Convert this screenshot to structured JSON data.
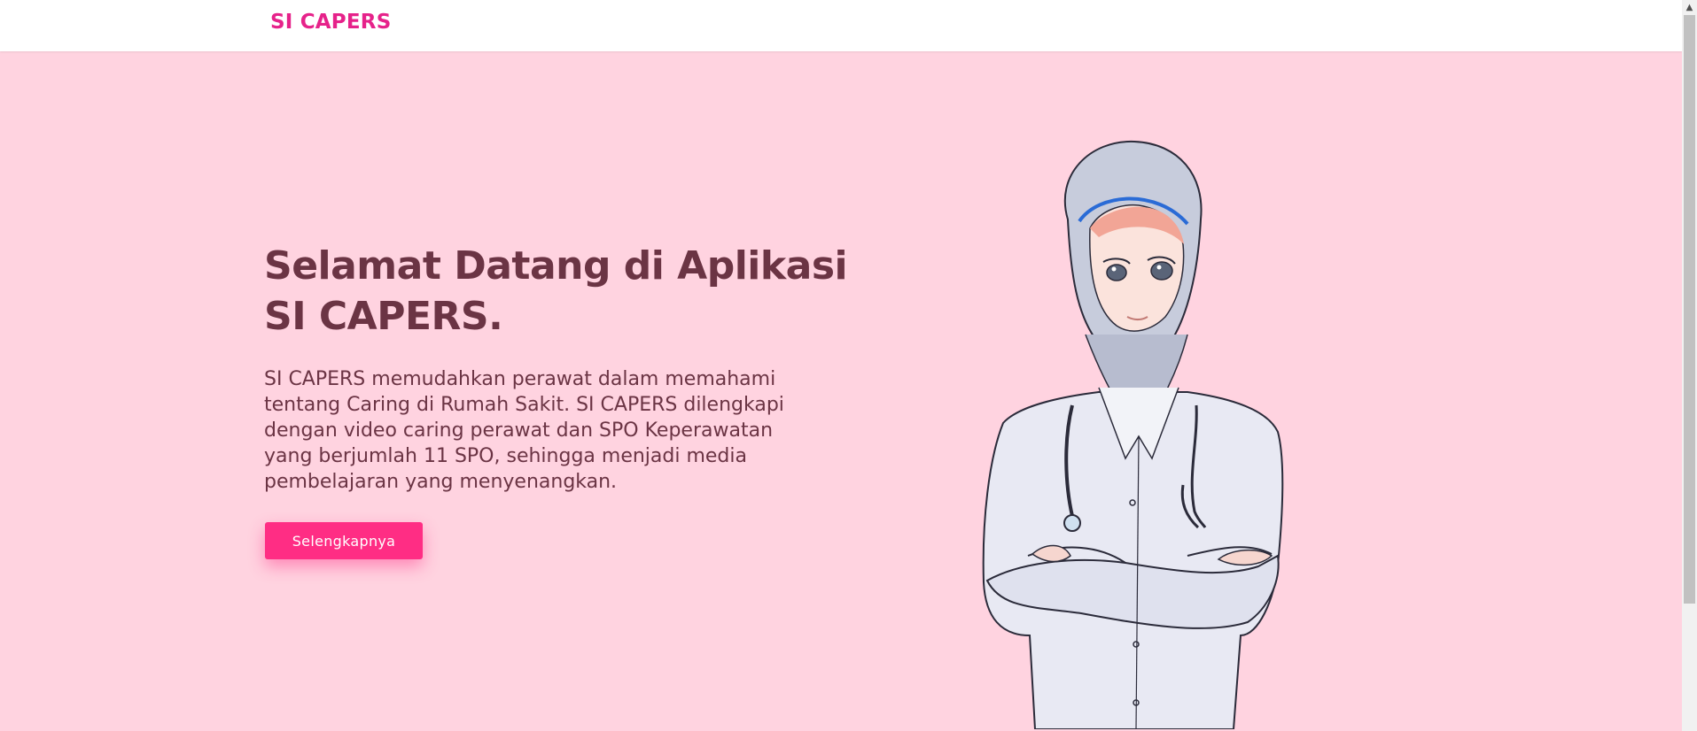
{
  "navbar": {
    "brand": "SI CAPERS"
  },
  "hero": {
    "title": "Selamat Datang di Aplikasi SI CAPERS.",
    "description": "SI CAPERS memudahkan perawat dalam memahami tentang Caring di Rumah Sakit. SI CAPERS dilengkapi dengan video caring perawat dan SPO Keperawatan yang berjumlah 11 SPO, sehingga menjadi media pembelajaran yang menyenangkan.",
    "cta_label": "Selengkapnya"
  },
  "colors": {
    "brand": "#e6228a",
    "hero_background": "#ffd3e0",
    "heading_text": "#6b3444",
    "button": "#ff2d84"
  },
  "icons": {
    "scroll_up": "chevron-up-icon"
  }
}
